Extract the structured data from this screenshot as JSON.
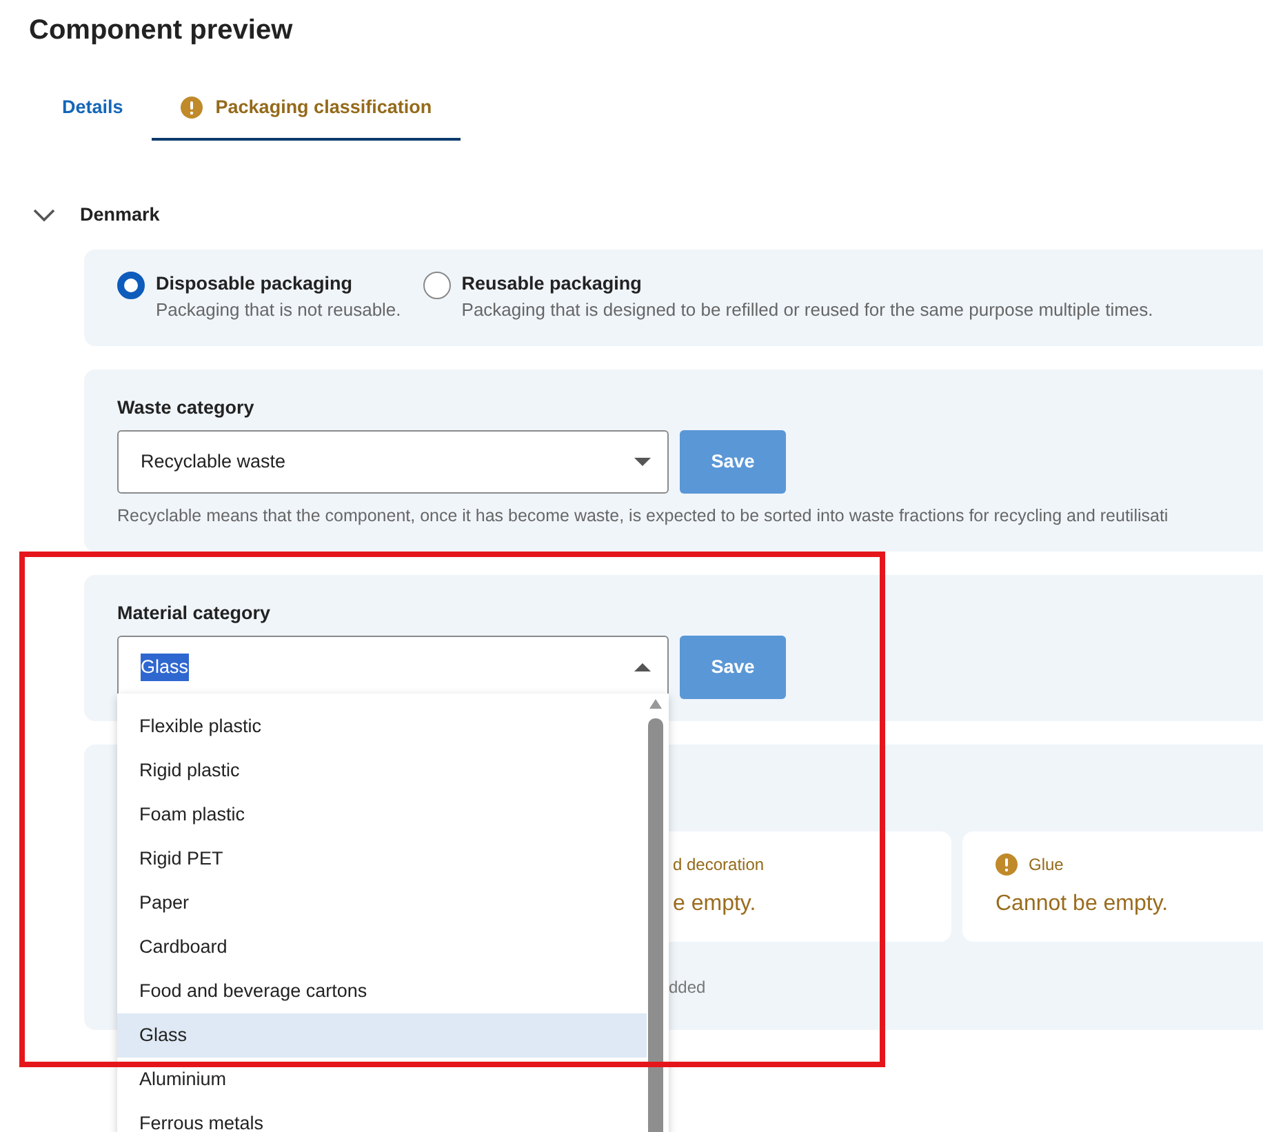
{
  "page_title": "Component preview",
  "tabs": [
    {
      "label": "Details",
      "selected": false,
      "warning": false
    },
    {
      "label": "Packaging classification",
      "selected": true,
      "warning": true
    }
  ],
  "region": {
    "name": "Denmark",
    "expanded": true,
    "packaging_types": [
      {
        "label": "Disposable packaging",
        "description": "Packaging that is not reusable.",
        "selected": true
      },
      {
        "label": "Reusable packaging",
        "description": "Packaging that is designed to be refilled or reused for the same purpose multiple times.",
        "selected": false
      }
    ],
    "waste_category": {
      "label": "Waste category",
      "value": "Recyclable waste",
      "save": "Save",
      "help": "Recyclable means that the component, once it has become waste, is expected to be sorted into waste fractions for recycling and reutilisati"
    },
    "material_category": {
      "label": "Material category",
      "value": "Glass",
      "text_selected": true,
      "open": true,
      "save": "Save",
      "options": [
        {
          "label": "Flexible plastic",
          "selected": false
        },
        {
          "label": "Rigid plastic",
          "selected": false
        },
        {
          "label": "Foam plastic",
          "selected": false
        },
        {
          "label": "Rigid PET",
          "selected": false
        },
        {
          "label": "Paper",
          "selected": false
        },
        {
          "label": "Cardboard",
          "selected": false
        },
        {
          "label": "Food and beverage cartons",
          "selected": false
        },
        {
          "label": "Glass",
          "selected": true
        },
        {
          "label": "Aluminium",
          "selected": false
        },
        {
          "label": "Ferrous metals",
          "selected": false
        }
      ]
    },
    "components": {
      "cards": [
        {
          "label": "d decoration",
          "message": "e empty."
        },
        {
          "label": "Glue",
          "message": "Cannot be empty.",
          "warning": true
        }
      ],
      "note": "dded"
    }
  },
  "annotation": {
    "shown": true
  }
}
